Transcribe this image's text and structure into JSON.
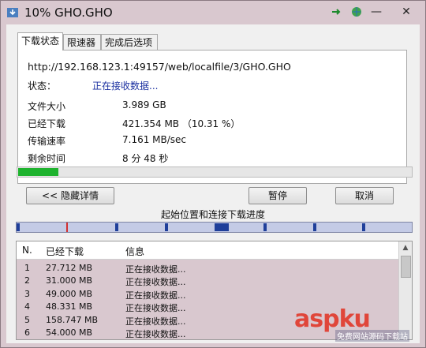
{
  "window": {
    "title": "10% GHO.GHO",
    "controls": {
      "arrow_icon": "arrow-right-icon",
      "globe_icon": "globe-icon",
      "minimize": "—",
      "close": "✕"
    }
  },
  "tabs": [
    {
      "label": "下载状态",
      "active": true
    },
    {
      "label": "限速器",
      "active": false
    },
    {
      "label": "完成后选项",
      "active": false
    }
  ],
  "status_panel": {
    "url": "http://192.168.123.1:49157/web/localfile/3/GHO.GHO",
    "status_label": "状态：",
    "status_value": "正在接收数据...",
    "rows": [
      {
        "label": "文件大小",
        "value": "3.989  GB"
      },
      {
        "label": "已经下载",
        "value": "421.354  MB  （10.31 %）"
      },
      {
        "label": "传输速率",
        "value": "7.161  MB/sec"
      },
      {
        "label": "剩余时间",
        "value": "8 分 48 秒"
      }
    ]
  },
  "progress": {
    "fraction": 0.1031
  },
  "buttons": {
    "details": "<< 隐藏详情",
    "pause": "暂停",
    "cancel": "取消"
  },
  "segments": {
    "title": "起始位置和连接下载进度",
    "blocks": [
      0.0,
      0.25,
      0.375,
      0.5,
      0.625,
      0.75,
      0.875
    ]
  },
  "connections": {
    "headers": {
      "n": "N.",
      "downloaded": "已经下载",
      "info": "信息"
    },
    "rows": [
      {
        "n": "1",
        "downloaded": "27.712 MB",
        "info": "正在接收数据..."
      },
      {
        "n": "2",
        "downloaded": "31.000 MB",
        "info": "正在接收数据..."
      },
      {
        "n": "3",
        "downloaded": "49.000 MB",
        "info": "正在接收数据..."
      },
      {
        "n": "4",
        "downloaded": "48.331 MB",
        "info": "正在接收数据..."
      },
      {
        "n": "5",
        "downloaded": "158.747 MB",
        "info": "正在接收数据..."
      },
      {
        "n": "6",
        "downloaded": "54.000 MB",
        "info": "正在接收数据..."
      }
    ]
  },
  "watermark": {
    "logo": "aspku",
    "sub": "免费网站源码下载站"
  },
  "colors": {
    "progress": "#1fb32f",
    "status_text": "#1a2fa0",
    "segment": "#1f3f9a"
  }
}
